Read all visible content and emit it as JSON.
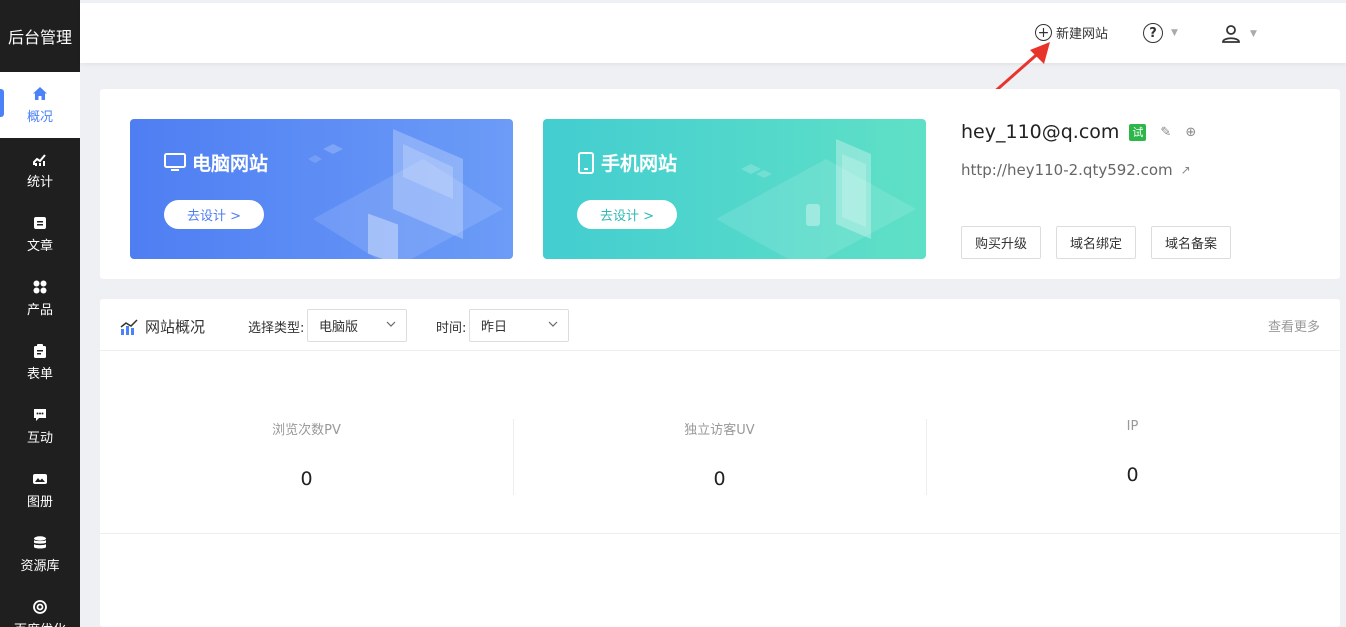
{
  "sidebar": {
    "brand": "后台管理",
    "items": [
      {
        "label": "概况",
        "icon": "home-icon",
        "active": true
      },
      {
        "label": "统计",
        "icon": "chart-icon"
      },
      {
        "label": "文章",
        "icon": "document-icon"
      },
      {
        "label": "产品",
        "icon": "grid-icon"
      },
      {
        "label": "表单",
        "icon": "clipboard-icon"
      },
      {
        "label": "互动",
        "icon": "chat-icon"
      },
      {
        "label": "图册",
        "icon": "gallery-icon"
      },
      {
        "label": "资源库",
        "icon": "database-icon"
      },
      {
        "label": "百度优化",
        "icon": "target-icon"
      }
    ]
  },
  "topbar": {
    "new_site_label": "新建网站",
    "help_icon": "help-icon",
    "user_icon": "user-icon"
  },
  "cards": {
    "pc": {
      "title": "电脑网站",
      "button": "去设计 >",
      "icon": "monitor-icon"
    },
    "mobile": {
      "title": "手机网站",
      "button": "去设计 >",
      "icon": "phone-icon"
    }
  },
  "account": {
    "email": "hey_110@q.com",
    "badge": "试",
    "url": "http://hey110-2.qty592.com",
    "buttons": [
      "购买升级",
      "域名绑定",
      "域名备案"
    ]
  },
  "overview": {
    "title": "网站概况",
    "type_label": "选择类型:",
    "type_value": "电脑版",
    "time_label": "时间:",
    "time_value": "昨日",
    "more": "查看更多",
    "stats": [
      {
        "label": "浏览次数PV",
        "value": "0"
      },
      {
        "label": "独立访客UV",
        "value": "0"
      },
      {
        "label": "IP",
        "value": "0"
      }
    ]
  },
  "colors": {
    "accent": "#4c82f7",
    "sidebar_bg": "#1f1f1f",
    "pc_card": "#5b8af5",
    "mobile_card": "#4fd6cb",
    "trial_badge": "#2db64a",
    "arrow": "#e8352c"
  }
}
